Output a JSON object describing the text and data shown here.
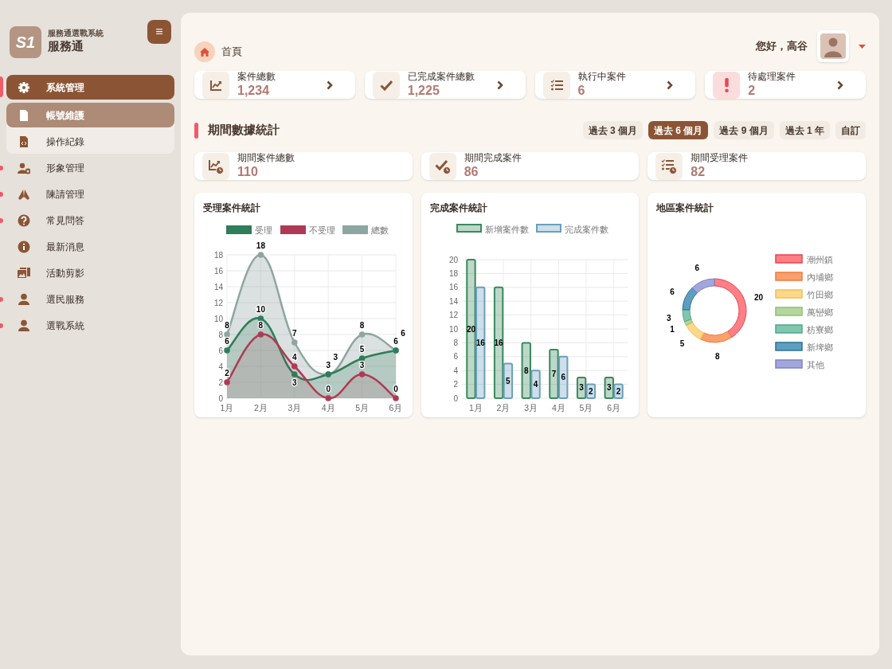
{
  "brand": {
    "logo": "S1",
    "subtitle": "服務通選戰系統",
    "title": "服務通"
  },
  "menu_button": "≡",
  "sidebar": {
    "items": [
      {
        "label": "系統管理",
        "selected": true,
        "alert": true,
        "expanded": true,
        "children": [
          {
            "label": "帳號維護",
            "selected": true
          },
          {
            "label": "操作紀錄",
            "selected": false
          }
        ]
      },
      {
        "label": "形象管理",
        "selected": false,
        "alert": true
      },
      {
        "label": "陳請管理",
        "selected": false,
        "alert": true
      },
      {
        "label": "常見問答",
        "selected": false,
        "alert": true
      },
      {
        "label": "最新消息",
        "selected": false,
        "alert": false
      },
      {
        "label": "活動剪影",
        "selected": false,
        "alert": false
      },
      {
        "label": "選民服務",
        "selected": false,
        "alert": true
      },
      {
        "label": "選戰系統",
        "selected": false,
        "alert": true
      }
    ]
  },
  "breadcrumb": "首頁",
  "greeting": "您好，高谷",
  "summary_cards": [
    {
      "kind": "trend",
      "label": "案件總數",
      "value": "1,234"
    },
    {
      "kind": "check",
      "label": "已完成案件總數",
      "value": "1,225"
    },
    {
      "kind": "list",
      "label": "執行中案件",
      "value": "6"
    },
    {
      "kind": "alert",
      "label": "待處理案件",
      "value": "2"
    }
  ],
  "section_title": "期間數據統計",
  "periods": [
    {
      "label": "過去 3 個月",
      "selected": false
    },
    {
      "label": "過去 6 個月",
      "selected": true
    },
    {
      "label": "過去 9 個月",
      "selected": false
    },
    {
      "label": "過去 1 年",
      "selected": false
    },
    {
      "label": "自訂",
      "selected": false
    }
  ],
  "period_cards": [
    {
      "kind": "trend",
      "label": "期間案件總數",
      "value": "110"
    },
    {
      "kind": "check",
      "label": "期間完成案件",
      "value": "86"
    },
    {
      "kind": "list",
      "label": "期間受理案件",
      "value": "82"
    }
  ],
  "charts": [
    {
      "title": "受理案件統計",
      "chart_data": {
        "type": "area",
        "categories": [
          "1月",
          "2月",
          "3月",
          "4月",
          "5月",
          "6月"
        ],
        "ylim": [
          0,
          18
        ],
        "yticks": [
          0,
          2,
          4,
          6,
          8,
          10,
          12,
          14,
          16,
          18
        ],
        "grid": true,
        "legend": "top",
        "data_labels": true,
        "series": [
          {
            "name": "受理",
            "color": "#2e7d5b",
            "values": [
              6,
              10,
              3,
              3,
              5,
              6
            ]
          },
          {
            "name": "不受理",
            "color": "#b03a55",
            "values": [
              2,
              8,
              4,
              0,
              3,
              0
            ]
          },
          {
            "name": "總數",
            "color": "#8fa5a0",
            "values": [
              8,
              18,
              7,
              3,
              8,
              6
            ]
          }
        ]
      }
    },
    {
      "title": "完成案件統計",
      "chart_data": {
        "type": "bar",
        "categories": [
          "1月",
          "2月",
          "3月",
          "4月",
          "5月",
          "6月"
        ],
        "ylim": [
          0,
          20
        ],
        "yticks": [
          0,
          2,
          4,
          6,
          8,
          10,
          12,
          14,
          16,
          18,
          20
        ],
        "grid": true,
        "legend": "top",
        "data_labels": true,
        "series": [
          {
            "name": "新增案件數",
            "color": "#3a8a5e",
            "values": [
              20,
              16,
              8,
              7,
              3,
              3
            ]
          },
          {
            "name": "完成案件數",
            "color": "#6a9fbd",
            "values": [
              16,
              5,
              4,
              6,
              2,
              2
            ]
          }
        ]
      }
    },
    {
      "title": "地區案件統計",
      "chart_data": {
        "type": "donut",
        "categories": [
          "潮州鎮",
          "內埔鄉",
          "竹田鄉",
          "萬巒鄉",
          "枋寮鄉",
          "新埤鄉",
          "其他"
        ],
        "legend": "right",
        "data_labels": true,
        "values": [
          20,
          8,
          5,
          1,
          3,
          6,
          6
        ],
        "colors": [
          "#ff7f87",
          "#f9a06b",
          "#fdd78a",
          "#b5d69c",
          "#7fc8ae",
          "#5d9fc0",
          "#a3a6db"
        ]
      }
    }
  ]
}
